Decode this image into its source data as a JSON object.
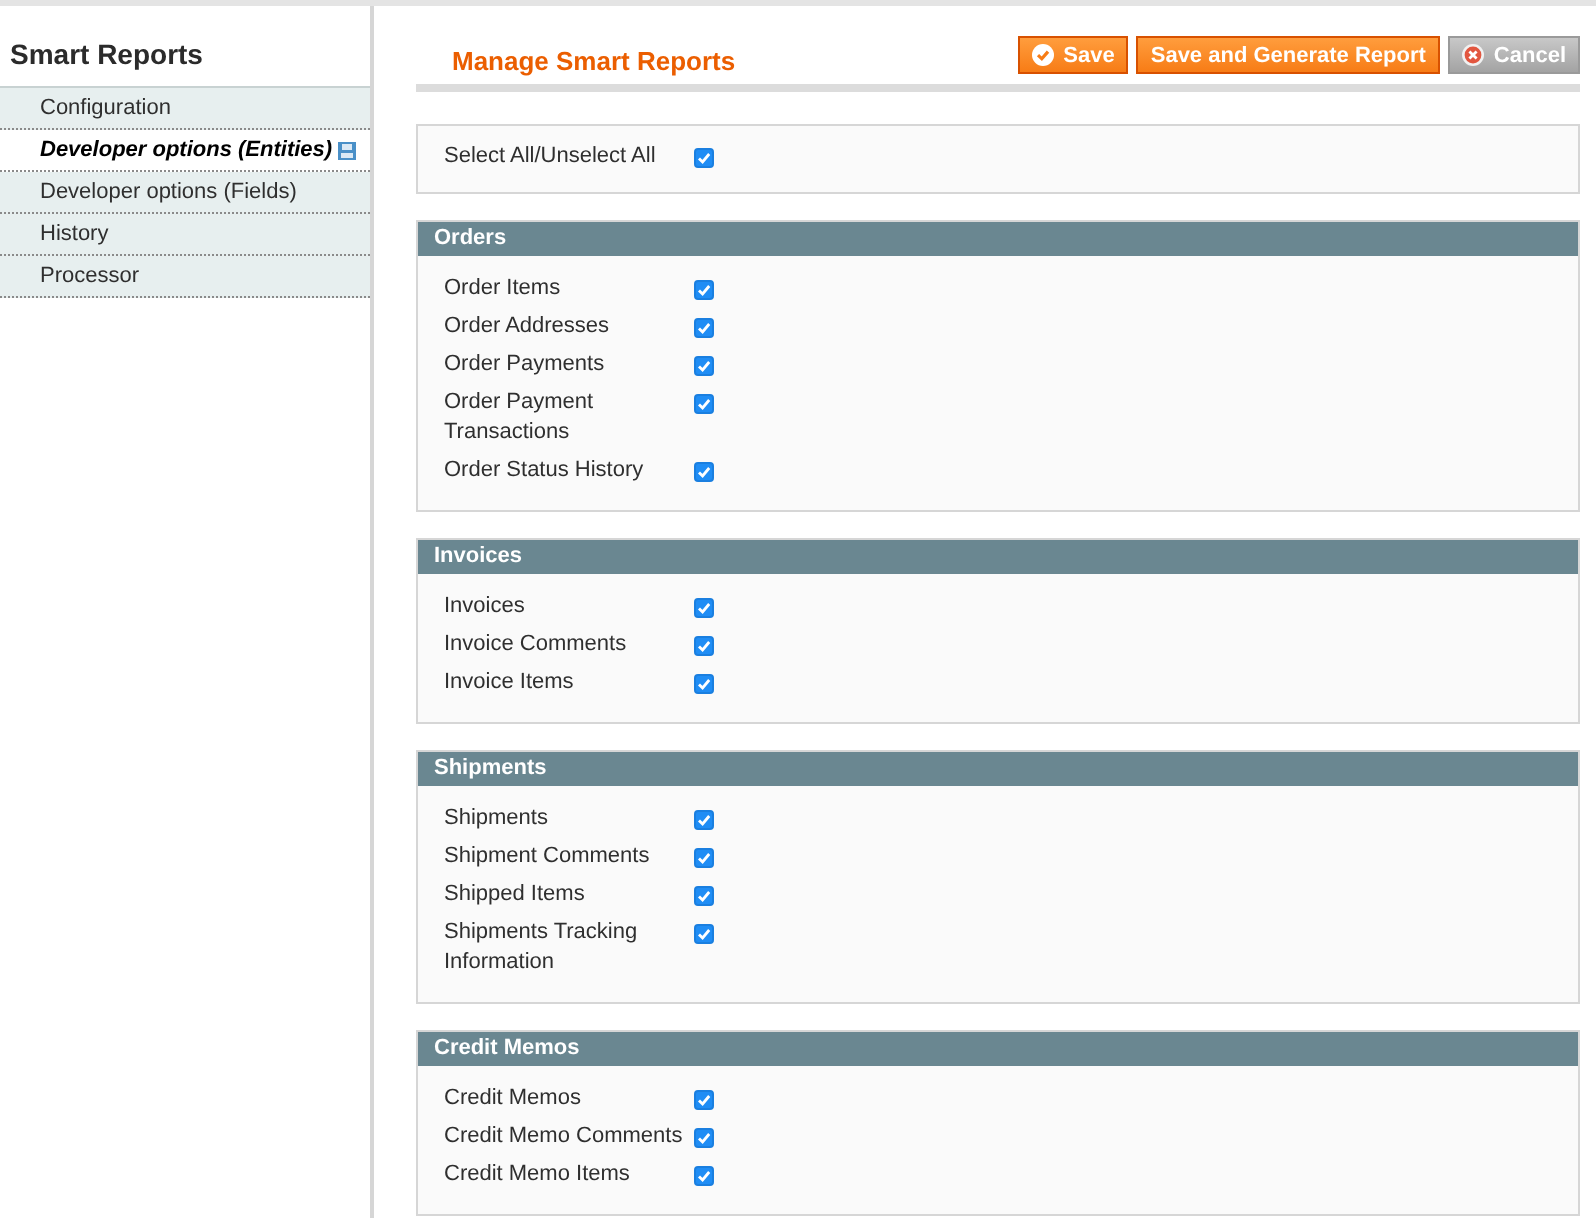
{
  "sidebar": {
    "title": "Smart Reports",
    "items": [
      {
        "label": "Configuration",
        "selected": false
      },
      {
        "label": "Developer options (Entities)",
        "selected": true
      },
      {
        "label": "Developer options (Fields)",
        "selected": false
      },
      {
        "label": "History",
        "selected": false
      },
      {
        "label": "Processor",
        "selected": false
      }
    ]
  },
  "page_title": "Manage Smart Reports",
  "buttons": [
    {
      "label": "Save",
      "kind": "save"
    },
    {
      "label": "Save and Generate Report",
      "kind": "primary"
    },
    {
      "label": "Cancel",
      "kind": "cancel"
    }
  ],
  "select_all": {
    "label": "Select All/Unselect All",
    "checked": true
  },
  "sections": [
    {
      "title": "Orders",
      "options": [
        {
          "label": "Order Items",
          "checked": true
        },
        {
          "label": "Order Addresses",
          "checked": true
        },
        {
          "label": "Order Payments",
          "checked": true
        },
        {
          "label": "Order Payment Transactions",
          "checked": true
        },
        {
          "label": "Order Status History",
          "checked": true
        }
      ]
    },
    {
      "title": "Invoices",
      "options": [
        {
          "label": "Invoices",
          "checked": true
        },
        {
          "label": "Invoice Comments",
          "checked": true
        },
        {
          "label": "Invoice Items",
          "checked": true
        }
      ]
    },
    {
      "title": "Shipments",
      "options": [
        {
          "label": "Shipments",
          "checked": true
        },
        {
          "label": "Shipment Comments",
          "checked": true
        },
        {
          "label": "Shipped Items",
          "checked": true
        },
        {
          "label": "Shipments Tracking Information",
          "checked": true
        }
      ]
    },
    {
      "title": "Credit Memos",
      "options": [
        {
          "label": "Credit Memos",
          "checked": true
        },
        {
          "label": "Credit Memo Comments",
          "checked": true
        },
        {
          "label": "Credit Memo Items",
          "checked": true
        }
      ]
    }
  ]
}
